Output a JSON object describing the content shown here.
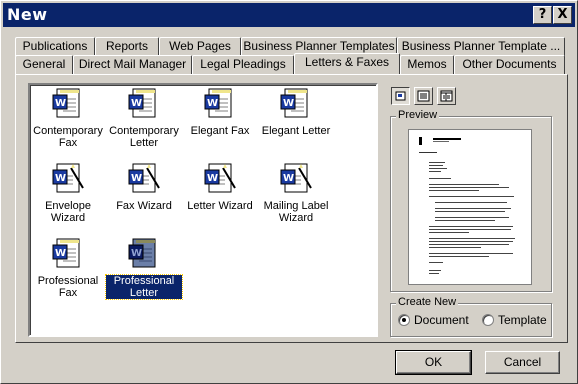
{
  "window": {
    "title": "New",
    "help_button": "?",
    "close_button": "X"
  },
  "tabs": {
    "back_row": [
      "Publications",
      "Reports",
      "Web Pages",
      "Business Planner Templates",
      "Business Planner Template ..."
    ],
    "front_row": [
      "General",
      "Direct Mail Manager",
      "Legal Pleadings",
      "Letters & Faxes",
      "Memos",
      "Other Documents"
    ],
    "active": "Letters & Faxes"
  },
  "templates": [
    {
      "label": "Contemporary Fax",
      "icon": "word-template-icon",
      "selected": false
    },
    {
      "label": "Contemporary Letter",
      "icon": "word-template-icon",
      "selected": false
    },
    {
      "label": "Elegant Fax",
      "icon": "word-template-icon",
      "selected": false
    },
    {
      "label": "Elegant Letter",
      "icon": "word-template-icon",
      "selected": false
    },
    {
      "label": "Envelope Wizard",
      "icon": "word-wizard-icon",
      "selected": false
    },
    {
      "label": "Fax Wizard",
      "icon": "word-wizard-icon",
      "selected": false
    },
    {
      "label": "Letter Wizard",
      "icon": "word-wizard-icon",
      "selected": false
    },
    {
      "label": "Mailing Label Wizard",
      "icon": "word-wizard-icon",
      "selected": false
    },
    {
      "label": "Professional Fax",
      "icon": "word-template-icon",
      "selected": false
    },
    {
      "label": "Professional Letter",
      "icon": "word-template-icon",
      "selected": true
    }
  ],
  "view_buttons": [
    "large-icons-view-icon",
    "list-view-icon",
    "details-view-icon"
  ],
  "preview": {
    "label": "Preview"
  },
  "create_new": {
    "label": "Create New",
    "options": [
      "Document",
      "Template"
    ],
    "selected": "Document"
  },
  "buttons": {
    "ok": "OK",
    "cancel": "Cancel"
  },
  "colors": {
    "titlebar": "#0a246a",
    "face": "#d4d0c8",
    "selection": "#0a246a"
  }
}
